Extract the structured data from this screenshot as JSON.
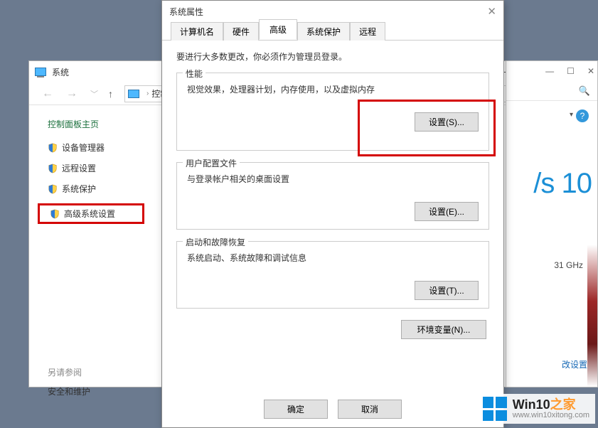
{
  "system_window": {
    "title": "系统",
    "breadcrumb": "控制面",
    "sidebar": {
      "heading": "控制面板主页",
      "items": [
        {
          "label": "设备管理器"
        },
        {
          "label": "远程设置"
        },
        {
          "label": "系统保护"
        },
        {
          "label": "高级系统设置"
        }
      ],
      "see_also_heading": "另请参阅",
      "see_also_link": "安全和维护"
    }
  },
  "properties_dialog": {
    "title": "系统属性",
    "tabs": [
      {
        "label": "计算机名"
      },
      {
        "label": "硬件"
      },
      {
        "label": "高级"
      },
      {
        "label": "系统保护"
      },
      {
        "label": "远程"
      }
    ],
    "active_tab_index": 2,
    "intro": "要进行大多数更改，你必须作为管理员登录。",
    "groups": {
      "performance": {
        "title": "性能",
        "desc": "视觉效果，处理器计划，内存使用，以及虚拟内存",
        "button": "设置(S)..."
      },
      "user_profiles": {
        "title": "用户配置文件",
        "desc": "与登录帐户相关的桌面设置",
        "button": "设置(E)..."
      },
      "startup": {
        "title": "启动和故障恢复",
        "desc": "系统启动、系统故障和调试信息",
        "button": "设置(T)..."
      }
    },
    "env_button": "环境变量(N)...",
    "ok_button": "确定",
    "cancel_button": "取消"
  },
  "background_window": {
    "os_fragment": "/s 10",
    "cpu_fragment": "31 GHz",
    "change_settings": "改设置"
  },
  "watermark": {
    "brand_main": "Win10",
    "brand_suffix": "之家",
    "url": "www.win10xitong.com"
  }
}
